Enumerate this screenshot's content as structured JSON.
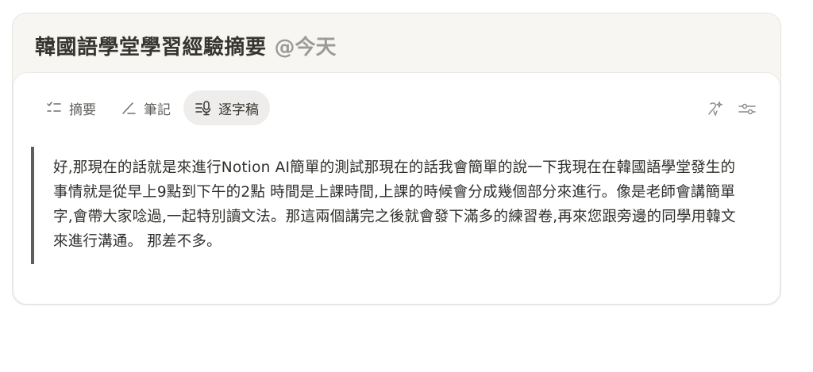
{
  "page": {
    "title": "韓國語學堂學習經驗摘要",
    "mention": "@今天"
  },
  "tabs": [
    {
      "label": "摘要",
      "icon": "checklist-icon",
      "active": false
    },
    {
      "label": "筆記",
      "icon": "pencil-icon",
      "active": false
    },
    {
      "label": "逐字稿",
      "icon": "transcript-mic-icon",
      "active": true
    }
  ],
  "tools": [
    {
      "icon": "ai-sparkle-icon"
    },
    {
      "icon": "sliders-icon"
    }
  ],
  "transcript": {
    "text": "好,那現在的話就是來進行Notion AI簡單的測試那現在的話我會簡單的說一下我現在在韓國語學堂發生的事情就是從早上9點到下午的2點 時間是上課時間,上課的時候會分成幾個部分來進行。像是老師會講簡單字,會帶大家唸過,一起特別讀文法。那這兩個講完之後就會發下滿多的練習卷,再來您跟旁邊的同學用韓文來進行溝通。 那差不多。"
  },
  "colors": {
    "card_bg": "#f7f6f3",
    "text": "#37352f",
    "muted": "#9b9a97",
    "active_tab_bg": "#eeedeb",
    "quote_bar": "#5f5e5b"
  }
}
